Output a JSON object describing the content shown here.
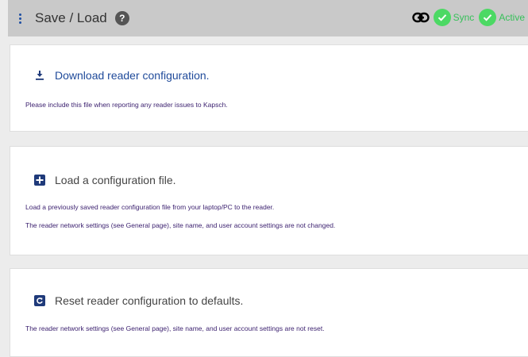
{
  "header": {
    "title": "Save / Load",
    "help": "?",
    "status_sync": "Sync",
    "status_active": "Active"
  },
  "download": {
    "label": "Download reader configuration.",
    "note": "Please include this file when reporting any reader issues to Kapsch."
  },
  "load": {
    "label": "Load a configuration file.",
    "note1": "Load a previously saved reader configuration file from your laptop/PC to the reader.",
    "note2": "The reader network settings (see General page), site name, and user account settings are not changed."
  },
  "reset": {
    "label": "Reset reader configuration to defaults.",
    "note": "The reader network settings (see General page), site name, and user account settings are not reset."
  },
  "icons": {
    "menu": "kebab-menu-icon",
    "help": "help-icon",
    "link": "link-icon",
    "check": "check-circle-icon",
    "download": "download-icon",
    "add": "plus-box-icon",
    "reset": "reset-icon"
  },
  "colors": {
    "header_bg": "#c9c9c9",
    "success": "#4cd964",
    "primary": "#1f4a9a",
    "note_text": "#3a1f6e"
  }
}
